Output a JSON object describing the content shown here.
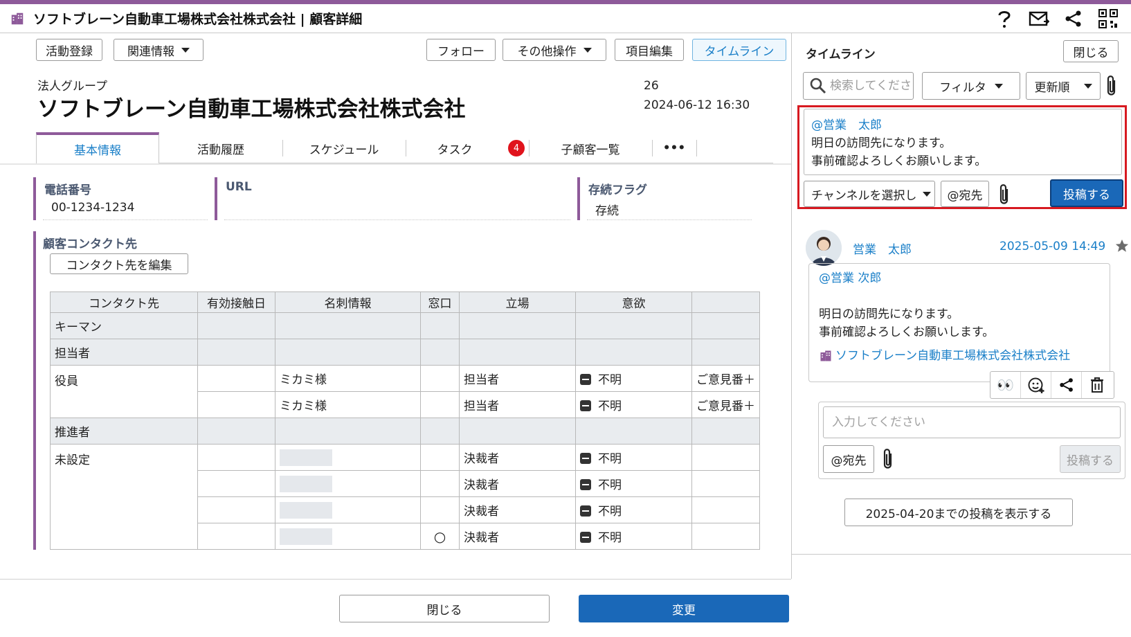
{
  "window": {
    "title": "ソフトブレーン自動車工場株式会社株式会社 | 顧客詳細"
  },
  "toolbar": {
    "activity_register": "活動登録",
    "related_info": "関連情報",
    "follow": "フォロー",
    "other_actions": "その他操作",
    "edit_fields": "項目編集",
    "timeline": "タイムライン"
  },
  "customer": {
    "group": "法人グループ",
    "name": "ソフトブレーン自動車工場株式会社株式会社",
    "count": "26",
    "datetime": "2024-06-12  16:30"
  },
  "tabs": [
    {
      "label": "基本情報"
    },
    {
      "label": "活動履歴"
    },
    {
      "label": "スケジュール"
    },
    {
      "label": "タスク",
      "badge": "4"
    },
    {
      "label": "子顧客一覧"
    },
    {
      "label": "•••"
    }
  ],
  "fields": {
    "phone": {
      "label": "電話番号",
      "value": "00-1234-1234"
    },
    "url": {
      "label": "URL",
      "value": ""
    },
    "active_flag": {
      "label": "存続フラグ",
      "value": "存続"
    }
  },
  "contacts": {
    "title": "顧客コンタクト先",
    "edit_button": "コンタクト先を編集",
    "headers": [
      "コンタクト先",
      "有効接触日",
      "名刺情報",
      "窓口",
      "立場",
      "意欲",
      ""
    ],
    "groups": {
      "keyman": "キーマン",
      "tantou": "担当者",
      "yakuin": "役員",
      "suishin": "推進者",
      "misettei": "未設定"
    },
    "rows": [
      {
        "card": "ミカミ様",
        "window": "",
        "role": "担当者",
        "motivation": "不明",
        "extra": "ご意見番＋"
      },
      {
        "card": "ミカミ様",
        "window": "",
        "role": "担当者",
        "motivation": "不明",
        "extra": "ご意見番＋"
      },
      {
        "card": "",
        "window": "",
        "role": "決裁者",
        "motivation": "不明",
        "extra": ""
      },
      {
        "card": "",
        "window": "",
        "role": "決裁者",
        "motivation": "不明",
        "extra": ""
      },
      {
        "card": "",
        "window": "",
        "role": "決裁者",
        "motivation": "不明",
        "extra": ""
      },
      {
        "card": "",
        "window": "○",
        "role": "決裁者",
        "motivation": "不明",
        "extra": ""
      }
    ]
  },
  "footer": {
    "close": "閉じる",
    "change": "変更"
  },
  "timeline": {
    "title": "タイムライン",
    "close": "閉じる",
    "search_placeholder": "検索してください",
    "filter": "フィルタ",
    "sort": "更新順",
    "composer": {
      "mention": "@営業　太郎",
      "line1": "明日の訪問先になります。",
      "line2": "事前確認よろしくお願いします。",
      "channel": "チャンネルを選択し",
      "address": "@宛先",
      "post": "投稿する"
    },
    "post": {
      "user": "営業　太郎",
      "date": "2025-05-09 14:49",
      "mention": "@営業 次郎",
      "line1": "明日の訪問先になります。",
      "line2": "事前確認よろしくお願いします。",
      "link": "ソフトブレーン自動車工場株式会社株式会社",
      "eyes": "👀"
    },
    "reply": {
      "placeholder": "入力してください",
      "address": "@宛先",
      "post": "投稿する"
    },
    "more": "2025-04-20までの投稿を表示する"
  },
  "colors": {
    "accent": "#8e5a9a",
    "link": "#1a7fc8",
    "primary": "#1a68b8",
    "highlight": "#d71920",
    "badge": "#e0131c"
  }
}
